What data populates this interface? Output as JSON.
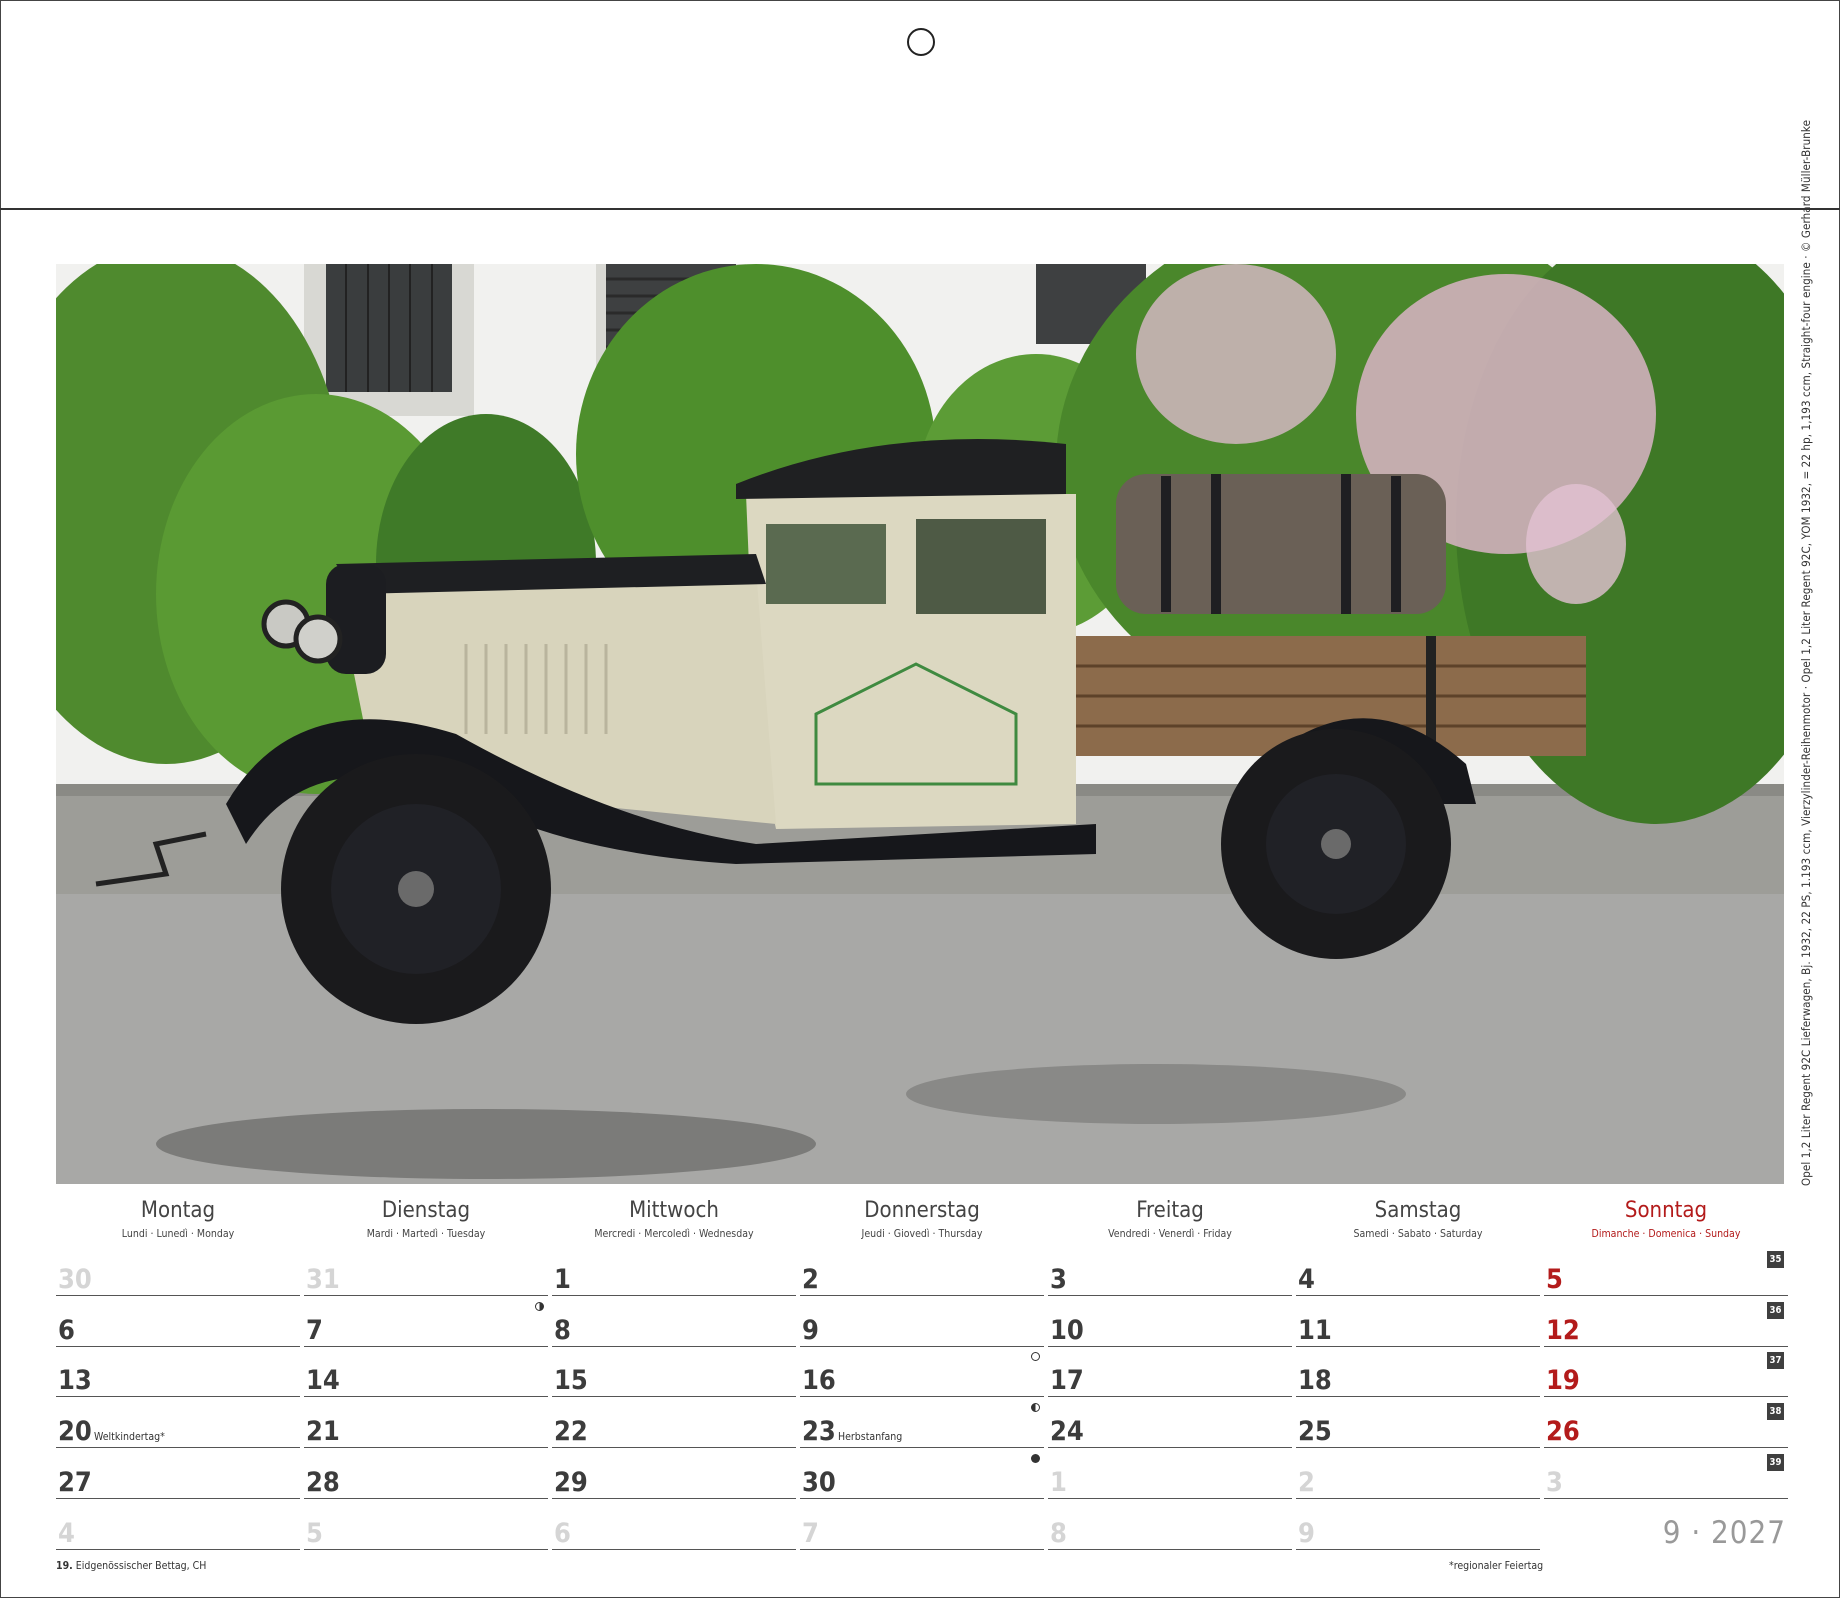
{
  "photo_caption": "Opel 1,2 Liter Regent 92C Lieferwagen, Bj. 1932, 22 PS, 1.193 ccm, Vierzylinder-Reihenmotor · Opel 1,2 Liter Regent 92C, YOM 1932, = 22 hp, 1,193 ccm, Straight-four engine · © Gerhard Müller-Brunke",
  "weekdays": [
    {
      "name": "Montag",
      "sub": "Lundi · Lunedì · Monday"
    },
    {
      "name": "Dienstag",
      "sub": "Mardi · Martedì · Tuesday"
    },
    {
      "name": "Mittwoch",
      "sub": "Mercredi · Mercoledì · Wednesday"
    },
    {
      "name": "Donnerstag",
      "sub": "Jeudi · Giovedì · Thursday"
    },
    {
      "name": "Freitag",
      "sub": "Vendredi · Venerdì · Friday"
    },
    {
      "name": "Samstag",
      "sub": "Samedi · Sabato · Saturday"
    },
    {
      "name": "Sonntag",
      "sub": "Dimanche · Domenica · Sunday"
    }
  ],
  "weeks": [
    {
      "week": "35",
      "days": [
        {
          "d": "30",
          "state": "other"
        },
        {
          "d": "31",
          "state": "other"
        },
        {
          "d": "1"
        },
        {
          "d": "2"
        },
        {
          "d": "3"
        },
        {
          "d": "4"
        },
        {
          "d": "5",
          "state": "sunday"
        }
      ]
    },
    {
      "week": "36",
      "days": [
        {
          "d": "6"
        },
        {
          "d": "7",
          "moon": "first"
        },
        {
          "d": "8"
        },
        {
          "d": "9"
        },
        {
          "d": "10"
        },
        {
          "d": "11"
        },
        {
          "d": "12",
          "state": "sunday"
        }
      ]
    },
    {
      "week": "37",
      "days": [
        {
          "d": "13"
        },
        {
          "d": "14"
        },
        {
          "d": "15"
        },
        {
          "d": "16",
          "moon": "full"
        },
        {
          "d": "17"
        },
        {
          "d": "18"
        },
        {
          "d": "19",
          "state": "sunday"
        }
      ]
    },
    {
      "week": "38",
      "days": [
        {
          "d": "20",
          "note": "Weltkindertag*"
        },
        {
          "d": "21"
        },
        {
          "d": "22"
        },
        {
          "d": "23",
          "note": "Herbstanfang",
          "moon": "last"
        },
        {
          "d": "24"
        },
        {
          "d": "25"
        },
        {
          "d": "26",
          "state": "sunday"
        }
      ]
    },
    {
      "week": "39",
      "days": [
        {
          "d": "27"
        },
        {
          "d": "28"
        },
        {
          "d": "29"
        },
        {
          "d": "30",
          "moon": "new"
        },
        {
          "d": "1",
          "state": "other"
        },
        {
          "d": "2",
          "state": "other"
        },
        {
          "d": "3",
          "state": "other"
        }
      ]
    },
    {
      "week": "",
      "days": [
        {
          "d": "4",
          "state": "other"
        },
        {
          "d": "5",
          "state": "other"
        },
        {
          "d": "6",
          "state": "other"
        },
        {
          "d": "7",
          "state": "other"
        },
        {
          "d": "8",
          "state": "other"
        },
        {
          "d": "9",
          "state": "other"
        }
      ]
    }
  ],
  "month_label": "9 · 2027",
  "footer": {
    "holiday_day": "19.",
    "holiday_text": "Eidgenössischer Bettag, CH",
    "footnote": "*regionaler Feiertag"
  },
  "colors": {
    "sunday": "#b31b1b",
    "grid_line": "#555555",
    "week_badge": "#3f3f3f"
  }
}
